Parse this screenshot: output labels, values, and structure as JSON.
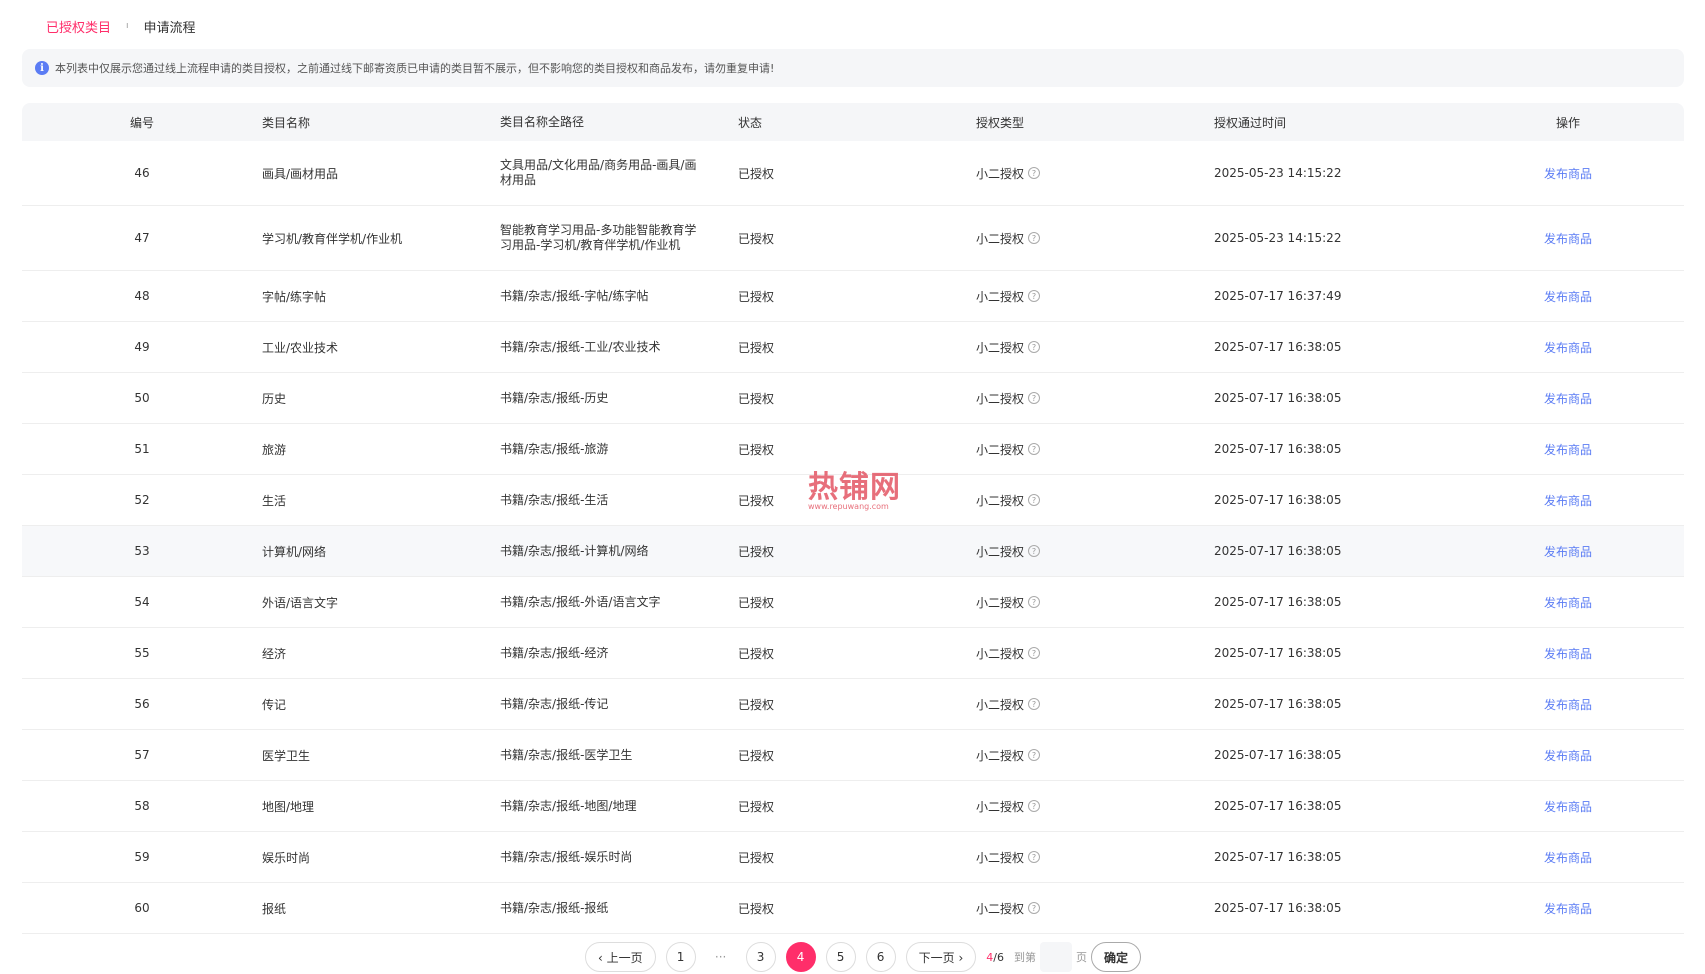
{
  "tabs": {
    "active": "已授权类目",
    "separator": "ı",
    "other": "申请流程"
  },
  "notice": {
    "icon": "info-icon",
    "icon_glyph": "i",
    "text": "本列表中仅展示您通过线上流程申请的类目授权，之前通过线下邮寄资质已申请的类目暂不展示，但不影响您的类目授权和商品发布，请勿重复申请!"
  },
  "table": {
    "headers": {
      "id": "编号",
      "name": "类目名称",
      "path": "类目名称全路径",
      "status": "状态",
      "type": "授权类型",
      "time": "授权通过时间",
      "action": "操作"
    },
    "help_glyph": "?",
    "rows": [
      {
        "id": "46",
        "name": "画具/画材用品",
        "path": "文具用品/文化用品/商务用品-画具/画材用品",
        "status": "已授权",
        "type": "小二授权",
        "time": "2025-05-23 14:15:22",
        "action": "发布商品"
      },
      {
        "id": "47",
        "name": "学习机/教育伴学机/作业机",
        "path": "智能教育学习用品-多功能智能教育学习用品-学习机/教育伴学机/作业机",
        "status": "已授权",
        "type": "小二授权",
        "time": "2025-05-23 14:15:22",
        "action": "发布商品"
      },
      {
        "id": "48",
        "name": "字帖/练字帖",
        "path": "书籍/杂志/报纸-字帖/练字帖",
        "status": "已授权",
        "type": "小二授权",
        "time": "2025-07-17 16:37:49",
        "action": "发布商品"
      },
      {
        "id": "49",
        "name": "工业/农业技术",
        "path": "书籍/杂志/报纸-工业/农业技术",
        "status": "已授权",
        "type": "小二授权",
        "time": "2025-07-17 16:38:05",
        "action": "发布商品"
      },
      {
        "id": "50",
        "name": "历史",
        "path": "书籍/杂志/报纸-历史",
        "status": "已授权",
        "type": "小二授权",
        "time": "2025-07-17 16:38:05",
        "action": "发布商品"
      },
      {
        "id": "51",
        "name": "旅游",
        "path": "书籍/杂志/报纸-旅游",
        "status": "已授权",
        "type": "小二授权",
        "time": "2025-07-17 16:38:05",
        "action": "发布商品"
      },
      {
        "id": "52",
        "name": "生活",
        "path": "书籍/杂志/报纸-生活",
        "status": "已授权",
        "type": "小二授权",
        "time": "2025-07-17 16:38:05",
        "action": "发布商品"
      },
      {
        "id": "53",
        "name": "计算机/网络",
        "path": "书籍/杂志/报纸-计算机/网络",
        "status": "已授权",
        "type": "小二授权",
        "time": "2025-07-17 16:38:05",
        "action": "发布商品"
      },
      {
        "id": "54",
        "name": "外语/语言文字",
        "path": "书籍/杂志/报纸-外语/语言文字",
        "status": "已授权",
        "type": "小二授权",
        "time": "2025-07-17 16:38:05",
        "action": "发布商品"
      },
      {
        "id": "55",
        "name": "经济",
        "path": "书籍/杂志/报纸-经济",
        "status": "已授权",
        "type": "小二授权",
        "time": "2025-07-17 16:38:05",
        "action": "发布商品"
      },
      {
        "id": "56",
        "name": "传记",
        "path": "书籍/杂志/报纸-传记",
        "status": "已授权",
        "type": "小二授权",
        "time": "2025-07-17 16:38:05",
        "action": "发布商品"
      },
      {
        "id": "57",
        "name": "医学卫生",
        "path": "书籍/杂志/报纸-医学卫生",
        "status": "已授权",
        "type": "小二授权",
        "time": "2025-07-17 16:38:05",
        "action": "发布商品"
      },
      {
        "id": "58",
        "name": "地图/地理",
        "path": "书籍/杂志/报纸-地图/地理",
        "status": "已授权",
        "type": "小二授权",
        "time": "2025-07-17 16:38:05",
        "action": "发布商品"
      },
      {
        "id": "59",
        "name": "娱乐时尚",
        "path": "书籍/杂志/报纸-娱乐时尚",
        "status": "已授权",
        "type": "小二授权",
        "time": "2025-07-17 16:38:05",
        "action": "发布商品"
      },
      {
        "id": "60",
        "name": "报纸",
        "path": "书籍/杂志/报纸-报纸",
        "status": "已授权",
        "type": "小二授权",
        "time": "2025-07-17 16:38:05",
        "action": "发布商品"
      }
    ]
  },
  "watermark": {
    "main": "热铺网",
    "sub": "www.repuwang.com"
  },
  "pagination": {
    "prev": "‹ 上一页",
    "next": "下一页 ›",
    "first": "1",
    "ellipsis": "···",
    "pages": [
      "3",
      "4",
      "5",
      "6"
    ],
    "active": "4",
    "current": "4",
    "total": "/6",
    "goto_label": "到第",
    "page_suffix": "页",
    "confirm": "确定"
  },
  "colors": {
    "accent": "#ff2e6a",
    "link": "#5b7cf4",
    "info": "#5b7cf4"
  }
}
